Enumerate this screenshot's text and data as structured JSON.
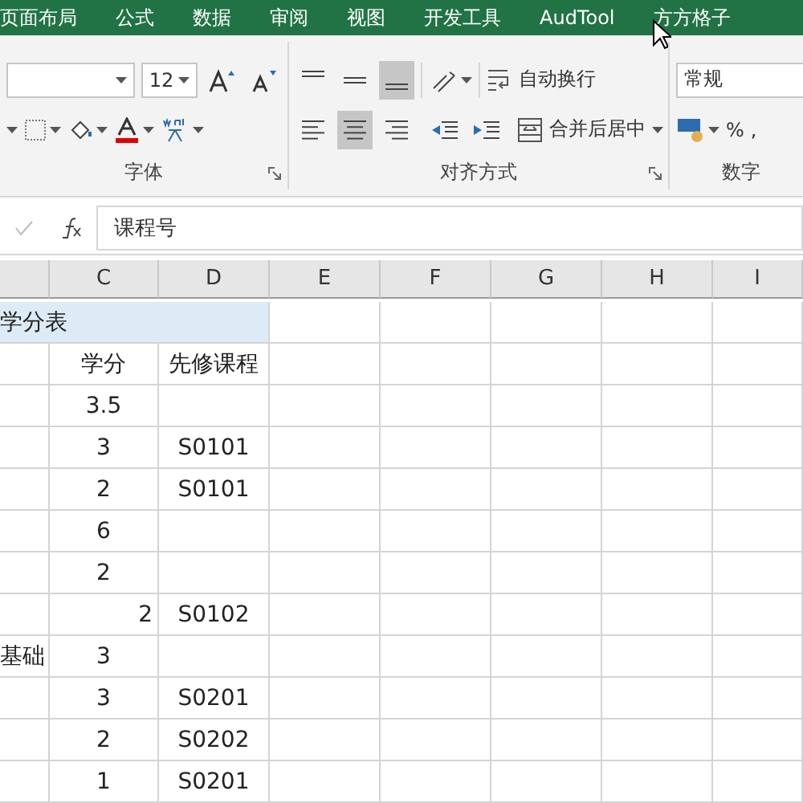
{
  "ribbon_tabs": [
    {
      "label": "页面布局",
      "selected": false
    },
    {
      "label": "公式",
      "selected": false
    },
    {
      "label": "数据",
      "selected": false
    },
    {
      "label": "审阅",
      "selected": false
    },
    {
      "label": "视图",
      "selected": false
    },
    {
      "label": "开发工具",
      "selected": false
    },
    {
      "label": "AudTool",
      "selected": false
    },
    {
      "label": "方方格子",
      "selected": false
    }
  ],
  "font_group": {
    "size": "12",
    "label": "字体"
  },
  "alignment_group": {
    "label": "对齐方式",
    "wrap_text": "自动换行",
    "merge_center": "合并后居中",
    "vertical_align": [
      {
        "kind": "top",
        "selected": false
      },
      {
        "kind": "middle",
        "selected": false
      },
      {
        "kind": "bottom",
        "selected": true
      }
    ],
    "horizontal_align": [
      {
        "kind": "left",
        "selected": false
      },
      {
        "kind": "center",
        "selected": true
      },
      {
        "kind": "right",
        "selected": false
      }
    ]
  },
  "number_group": {
    "format": "常规",
    "percent": "%",
    "comma": ",",
    "label": "数字"
  },
  "formula_bar": {
    "value": "课程号"
  },
  "columns": [
    "C",
    "D",
    "E",
    "F",
    "G",
    "H",
    "I"
  ],
  "rows": [
    {
      "kind": "title",
      "b": "学分表"
    },
    {
      "kind": "data",
      "c": "学分",
      "d": "先修课程"
    },
    {
      "kind": "data",
      "c": "3.5"
    },
    {
      "kind": "data",
      "c": "3",
      "d": "S0101"
    },
    {
      "kind": "data",
      "c": "2",
      "d": "S0101"
    },
    {
      "kind": "data",
      "c": "6"
    },
    {
      "kind": "data",
      "c": "2"
    },
    {
      "kind": "right_aligned",
      "c": "2",
      "d": "S0102"
    },
    {
      "kind": "data",
      "b": "基础",
      "c": "3"
    },
    {
      "kind": "data",
      "c": "3",
      "d": "S0201"
    },
    {
      "kind": "data",
      "c": "2",
      "d": "S0202"
    },
    {
      "kind": "data",
      "c": "1",
      "d": "S0201"
    }
  ]
}
